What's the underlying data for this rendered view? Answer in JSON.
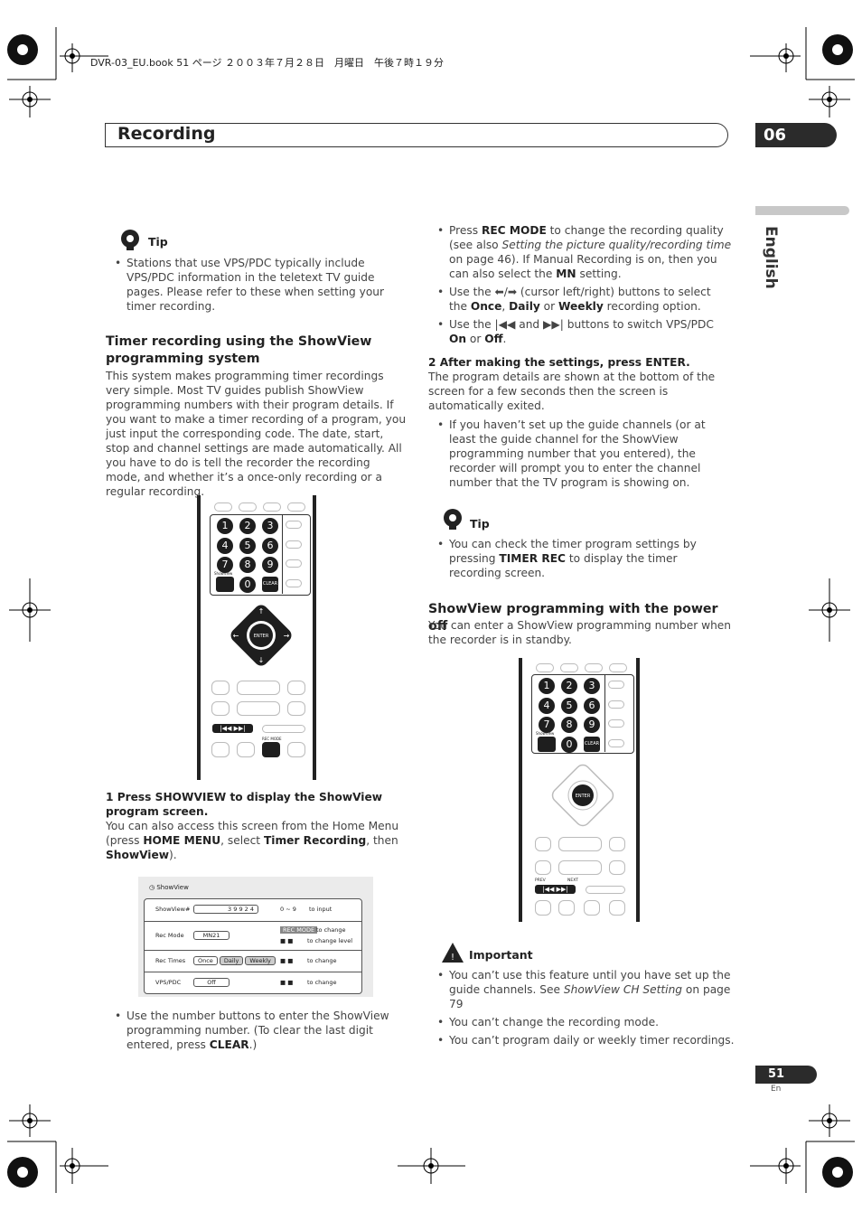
{
  "file_header": "DVR-03_EU.book  51 ページ  ２００３年７月２８日　月曜日　午後７時１９分",
  "section_title": "Recording",
  "chapter_number": "06",
  "language_label": "English",
  "page_number": "51",
  "page_lang": "En",
  "left": {
    "tip1": {
      "heading": "Tip",
      "bullets": [
        "Stations that use VPS/PDC typically include VPS/PDC information in the teletext TV guide pages. Please refer to these when setting your timer recording."
      ]
    },
    "section_heading": "Timer recording using the ShowView programming system",
    "intro": "This system makes programming timer recordings very simple. Most TV guides publish ShowView programming numbers with their program details. If you want to make a timer recording of a program, you just input the corresponding code. The date, start, stop and channel settings are made automatically. All you have to do is tell the recorder the recording mode, and whether it’s a once-only recording or a regular recording.",
    "step1_heading": "1    Press SHOWVIEW to display the ShowView program screen.",
    "step1_body": {
      "a": "You can also access this screen from the Home Menu (press ",
      "b1": "HOME MENU",
      "c": ", select ",
      "b2": "Timer Recording",
      "d": ", then ",
      "b3": "ShowView",
      "e": ")."
    },
    "bullet_after_screen": {
      "a": "Use the number buttons to enter the ShowView programming number. (To clear the last digit entered, press ",
      "b": "CLEAR",
      "c": ".)"
    }
  },
  "remote": {
    "numbers": [
      "1",
      "2",
      "3",
      "4",
      "5",
      "6",
      "7",
      "8",
      "9",
      "0"
    ],
    "showview_label": "ShowView",
    "clear_label": "CLEAR",
    "enter_label": "ENTER",
    "rec_mode_label": "REC MODE",
    "prev_label": "PREV",
    "next_label": "NEXT",
    "prev_icon": "|◀◀",
    "next_icon": "▶▶|"
  },
  "showview_screen": {
    "title": "ShowView",
    "rows": [
      {
        "label": "ShowView#",
        "value": "3 9 9 2 4",
        "hint_keys": "0 ~ 9",
        "hint": "to input"
      },
      {
        "label": "Rec  Mode",
        "value": "MN21",
        "hint_keys": "REC MODE",
        "hint": "to change",
        "hint2": "to change level"
      },
      {
        "label": "Rec  Times",
        "options": [
          "Once",
          "Daily",
          "Weekly"
        ],
        "hint": "to change"
      },
      {
        "label": "VPS/PDC",
        "value": "Off",
        "hint": "to change"
      }
    ]
  },
  "right": {
    "bullets_top": [
      {
        "a": "Press ",
        "b1": "REC MODE",
        "c": " to change the recording quality (see also ",
        "i": "Setting the picture quality/recording time",
        "d": " on page 46). If Manual Recording is on, then you can also select the ",
        "b2": "MN",
        "e": " setting."
      },
      {
        "a": "Use the ⬅/➡ (cursor left/right) buttons to select the ",
        "b1": "Once",
        "c": ", ",
        "b2": "Daily",
        "d": " or ",
        "b3": "Weekly",
        "e": " recording option."
      },
      {
        "a": "Use the |◀◀ and ▶▶| buttons to switch VPS/PDC ",
        "b1": "On",
        "c": " or ",
        "b2": "Off",
        "d": "."
      }
    ],
    "step2_heading": "2    After making the settings, press ENTER.",
    "step2_body": "The program details are shown at the bottom of the screen for a few seconds then the screen is automatically exited.",
    "step2_bullet": "If you haven’t set up the guide channels (or at least the guide channel for the ShowView programming number that you entered), the recorder will prompt you to enter the channel number that the TV program is showing on.",
    "tip2": {
      "heading": "Tip",
      "a": "You can check the timer program settings by pressing ",
      "b": "TIMER REC",
      "c": " to display the timer recording screen."
    },
    "section_heading": "ShowView programming with the power off",
    "section_body": "You can enter a ShowView programming number when the recorder is in standby.",
    "important": {
      "heading": "Important",
      "bullets": [
        {
          "a": "You can’t use this feature until you have set up the guide channels. See ",
          "i": "ShowView CH Setting",
          "c": " on page 79"
        },
        {
          "a": "You can’t change the recording mode."
        },
        {
          "a": "You can’t program daily or weekly timer recordings."
        }
      ]
    }
  }
}
